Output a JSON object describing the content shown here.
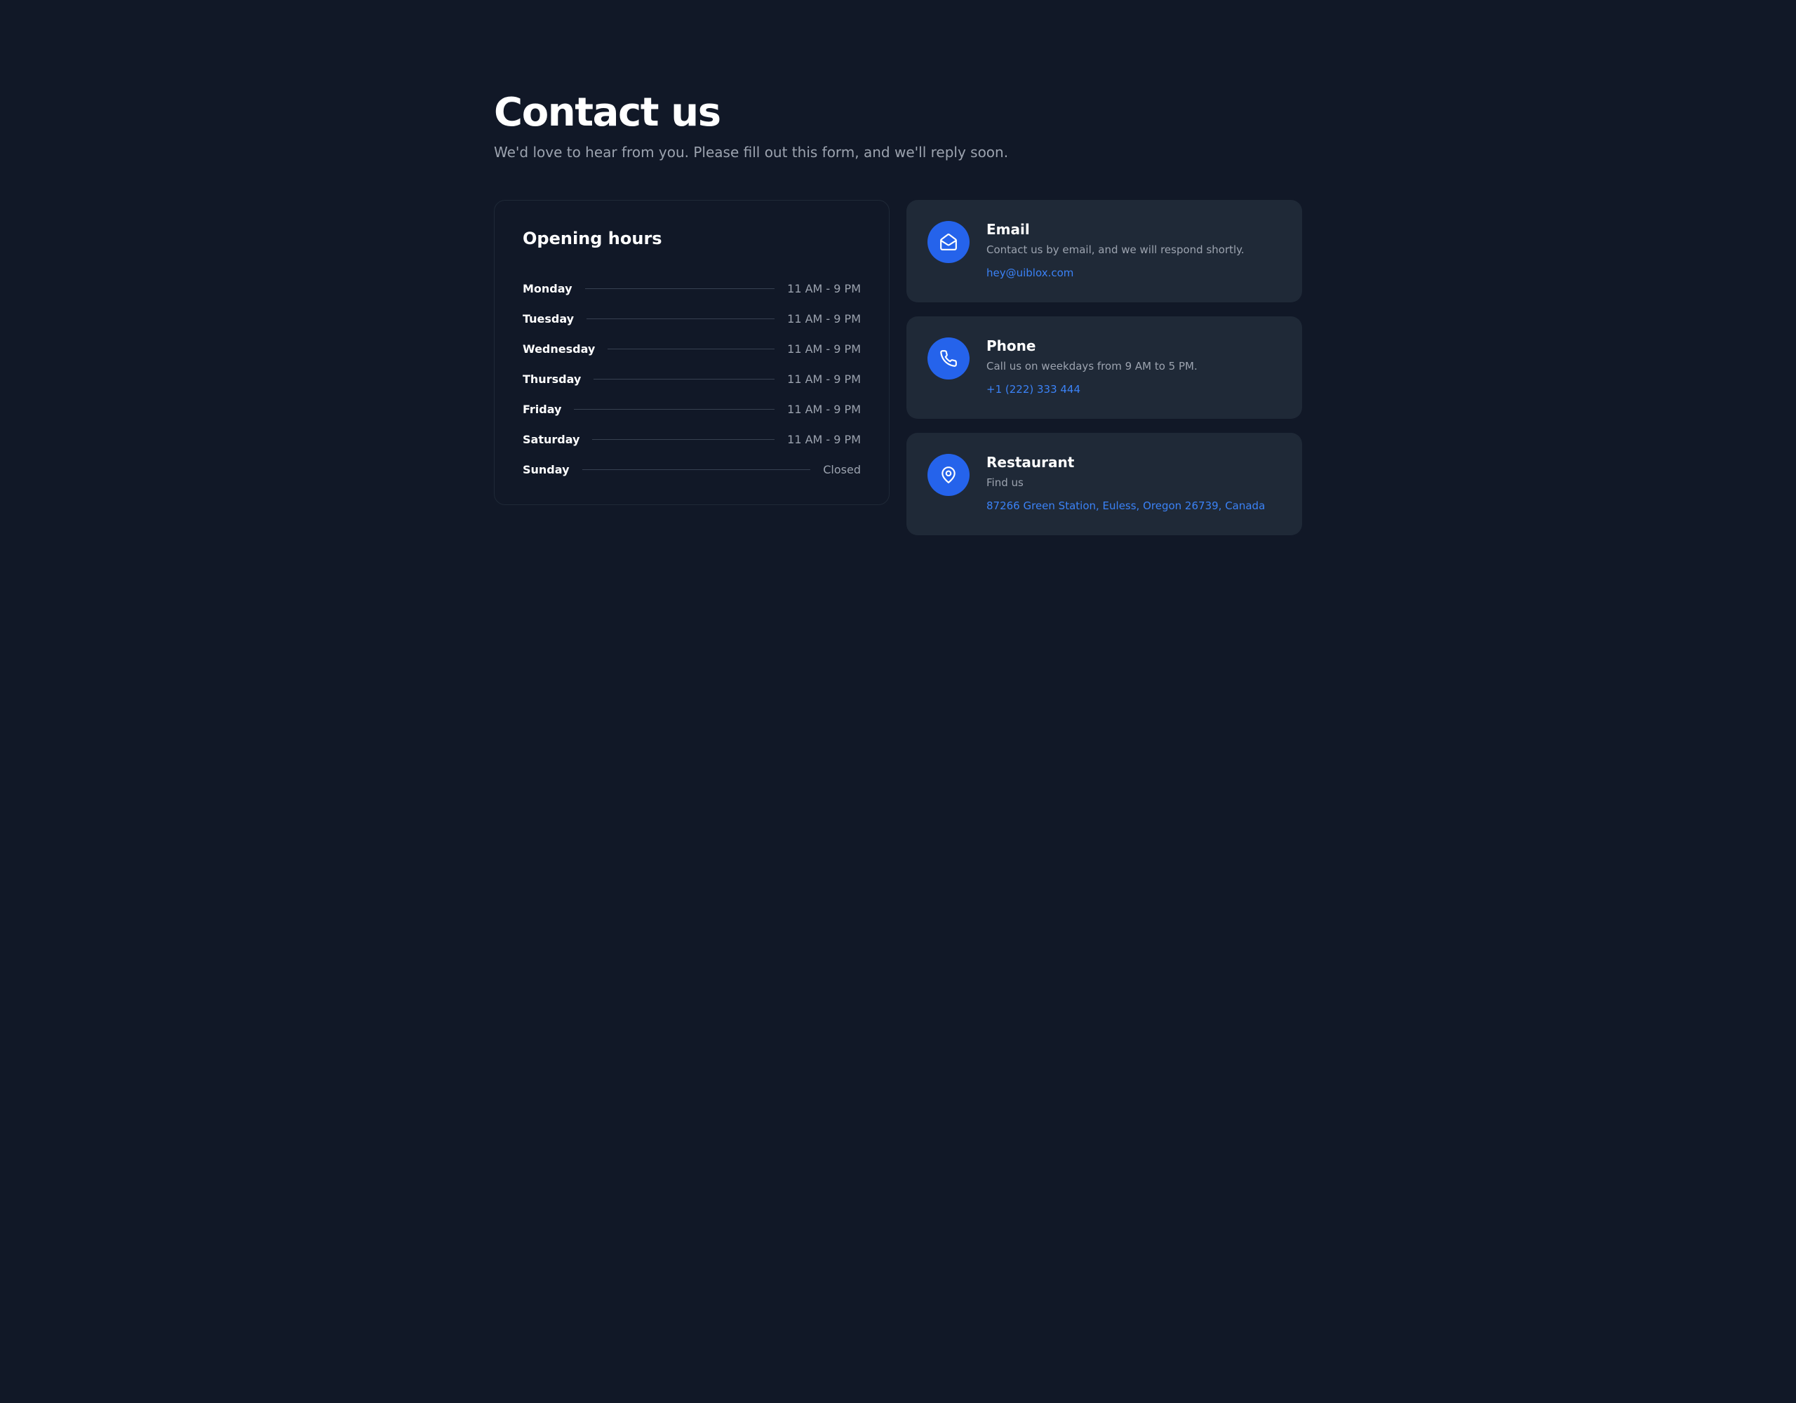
{
  "header": {
    "title": "Contact us",
    "subtitle": "We'd love to hear from you. Please fill out this form, and we'll reply soon."
  },
  "hours": {
    "title": "Opening hours",
    "rows": [
      {
        "day": "Monday",
        "time": "11 AM - 9 PM"
      },
      {
        "day": "Tuesday",
        "time": "11 AM - 9 PM"
      },
      {
        "day": "Wednesday",
        "time": "11 AM - 9 PM"
      },
      {
        "day": "Thursday",
        "time": "11 AM - 9 PM"
      },
      {
        "day": "Friday",
        "time": "11 AM - 9 PM"
      },
      {
        "day": "Saturday",
        "time": "11 AM - 9 PM"
      },
      {
        "day": "Sunday",
        "time": "Closed"
      }
    ]
  },
  "contacts": [
    {
      "icon": "email-icon",
      "title": "Email",
      "desc": "Contact us by email, and we will respond shortly.",
      "link_text": "hey@uiblox.com",
      "href": "mailto:hey@uiblox.com"
    },
    {
      "icon": "phone-icon",
      "title": "Phone",
      "desc": "Call us on weekdays from 9 AM to 5 PM.",
      "link_text": "+1 (222) 333 444",
      "href": "tel:+1222333444"
    },
    {
      "icon": "map-pin-icon",
      "title": "Restaurant",
      "desc": "Find us",
      "link_text": "87266 Green Station, Euless, Oregon 26739, Canada",
      "href": "#"
    }
  ]
}
